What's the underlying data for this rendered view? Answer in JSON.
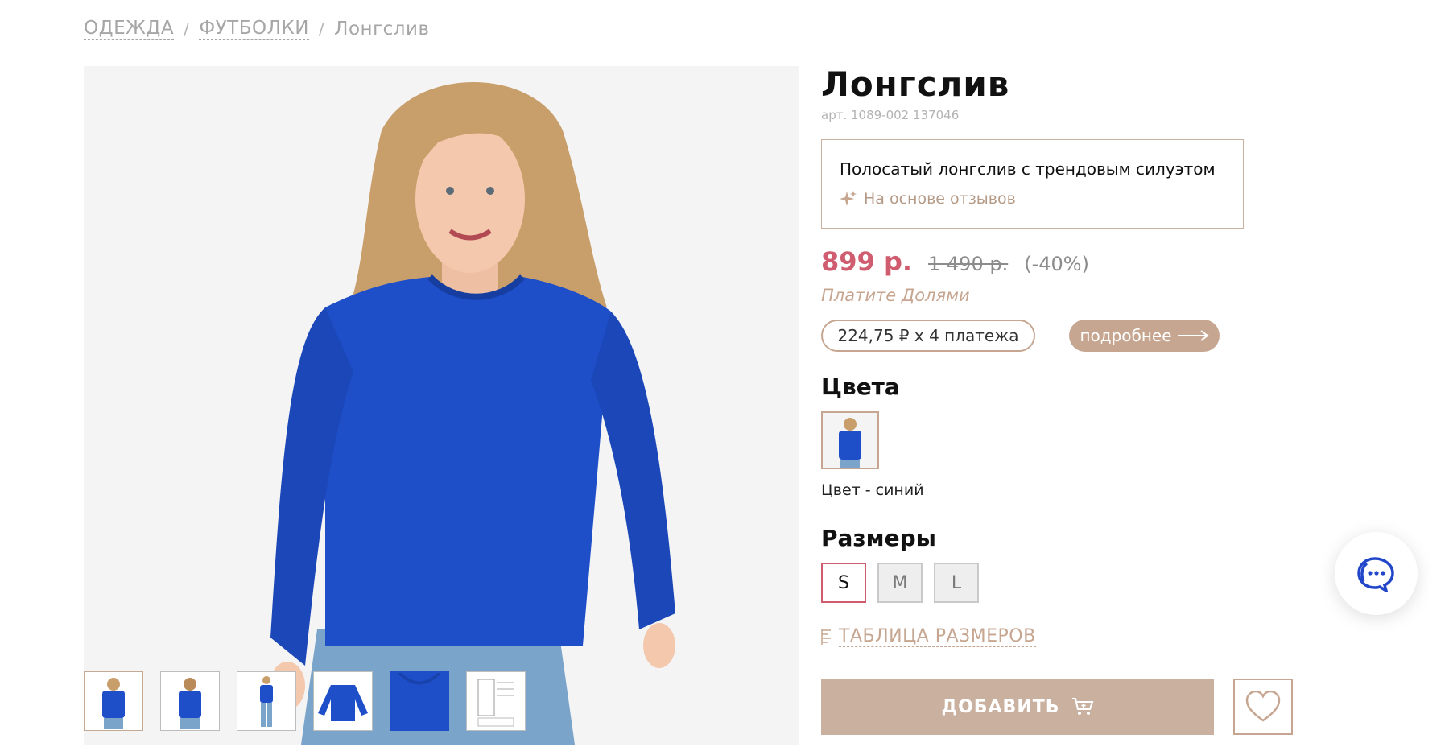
{
  "breadcrumb": {
    "items": [
      "ОДЕЖДА",
      "ФУТБОЛКИ"
    ],
    "current": "Лонгслив",
    "separator": "/"
  },
  "product": {
    "title": "Лонгслив",
    "article": "арт. 1089-002 137046"
  },
  "summary": {
    "text": "Полосатый лонгслив с трендовым силуэтом",
    "source": "На основе отзывов"
  },
  "price": {
    "current": "899 р.",
    "old": "1 490 р.",
    "discount": "(-40%)"
  },
  "installment": {
    "provider": "Платите Долями",
    "amount": "224,75 ₽ x 4 платежа",
    "more": "подробнее"
  },
  "colors": {
    "heading": "Цвета",
    "selected_label": "Цвет - синий",
    "swatch_color": "#1e4fc9"
  },
  "sizes": {
    "heading": "Размеры",
    "options": [
      "S",
      "M",
      "L"
    ],
    "selected": "S"
  },
  "size_table": {
    "label": "ТАБЛИЦА РАЗМЕРОВ"
  },
  "actions": {
    "add_label": "ДОБАВИТЬ"
  },
  "colors_theme": {
    "accent": "#c6a690",
    "price": "#d05c70",
    "shirt": "#1e4fc9"
  },
  "icons": [
    "sparkle-icon",
    "arrow-right-icon",
    "ruler-icon",
    "cart-icon",
    "heart-icon",
    "chat-icon"
  ]
}
